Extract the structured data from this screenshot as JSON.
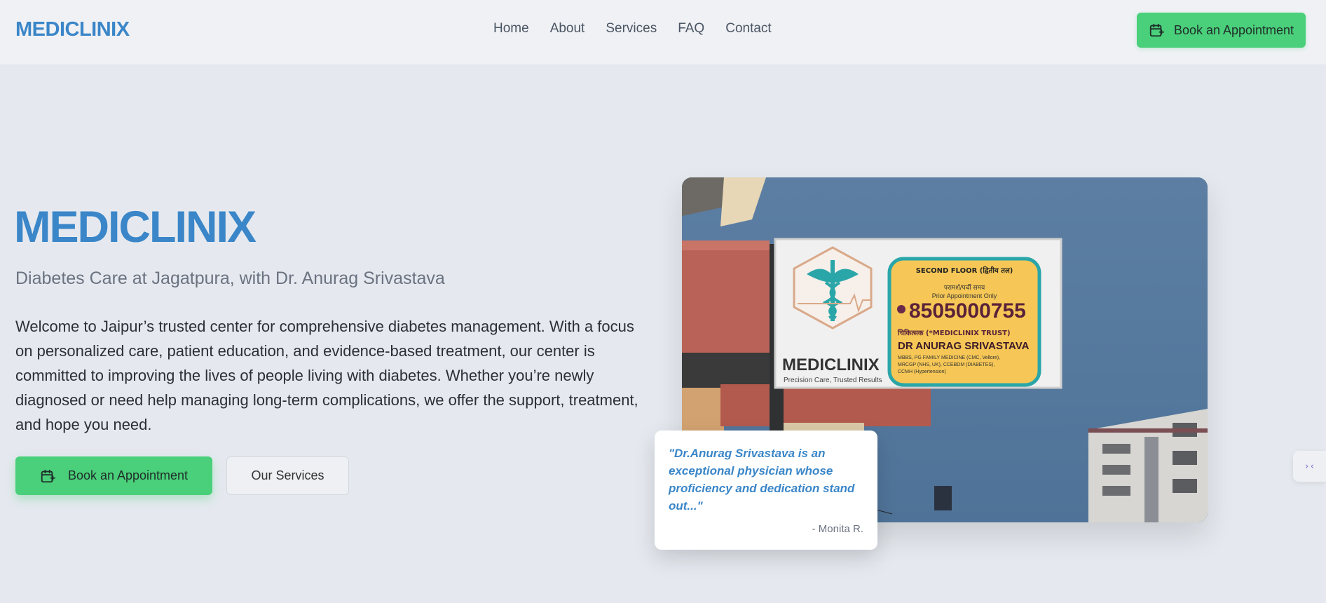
{
  "header": {
    "brand": "MEDICLINIX",
    "nav": [
      "Home",
      "About",
      "Services",
      "FAQ",
      "Contact"
    ],
    "cta_label": "Book an Appointment"
  },
  "hero": {
    "title": "MEDICLINIX",
    "subtitle": "Diabetes Care at Jagatpura, with Dr. Anurag Srivastava",
    "description": "Welcome to Jaipur’s trusted center for comprehensive diabetes management. With a focus on personalized care, patient education, and evidence-based treatment, our center is committed to improving the lives of people living with diabetes. Whether you’re newly diagnosed or need help managing long-term complications, we offer the support, treatment, and hope you need.",
    "primary_button": "Book an Appointment",
    "secondary_button": "Our Services"
  },
  "photo": {
    "sign_logo_text": "MEDICLINIX",
    "sign_tagline": "Precision Care, Trusted Results",
    "floor": "SECOND FLOOR (द्वितीय तल)",
    "consult_label": "परामर्श/पर्ची समय",
    "appointment_note": "Prior Appointment Only",
    "phone": "8505000755",
    "doctor_hindi_label": "चिकित्सक (*MEDICLINIX TRUST)",
    "doctor_name": "DR ANURAG SRIVASTAVA",
    "qualifications_1": "MBBS, PG FAMILY MEDICINE (CMC, Vellore),",
    "qualifications_2": "MRCGP (NHS, UK), CCEBDM (DIABETES),",
    "qualifications_3": "CCMH (Hypertension)"
  },
  "testimonial": {
    "quote": "\"Dr.Anurag Srivastava is an exceptional physician whose proficiency and dedication stand out...\"",
    "author": "- Monita R."
  },
  "widget": {
    "icon": "code-icon",
    "glyph": "›‹"
  },
  "colors": {
    "brand_blue": "#3a86c8",
    "accent_green": "#4ad07a",
    "background": "#e5e9ef",
    "sign_yellow": "#f6c756",
    "sign_teal": "#2aa6a8"
  }
}
